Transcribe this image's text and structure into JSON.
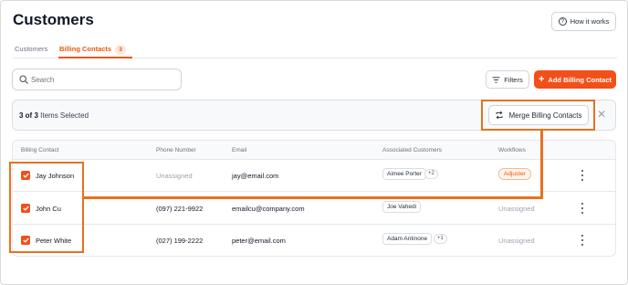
{
  "page": {
    "title": "Customers",
    "how_it_works": "How it works"
  },
  "tabs": [
    {
      "label": "Customers",
      "active": false
    },
    {
      "label": "Billing Contacts",
      "active": true,
      "count": "3"
    }
  ],
  "search": {
    "placeholder": "Search",
    "value": ""
  },
  "toolbar": {
    "filters_label": "Filters",
    "add_label": "Add Billing Contact"
  },
  "selection": {
    "count_text": "3 of 3",
    "suffix": "Items Selected",
    "merge_label": "Merge Billing Contacts"
  },
  "table": {
    "headers": [
      "Billing Contact",
      "Phone Number",
      "Email",
      "Associated Customers",
      "Workflows"
    ],
    "rows": [
      {
        "name": "Jay Johnson",
        "phone": "Unassigned",
        "email": "jay@email.com",
        "customer": "Aimee Porter",
        "more": "+2",
        "workflow": "Adjuster",
        "checked": true
      },
      {
        "name": "John Cu",
        "phone": "(097) 221-9922",
        "email": "emailcu@company.com",
        "customer": "Joe Vahedi",
        "more": "",
        "workflow": "Unassigned",
        "checked": true
      },
      {
        "name": "Peter White",
        "phone": "(027) 199-2222",
        "email": "peter@email.com",
        "customer": "Adam Antinone",
        "more": "+1",
        "workflow": "Unassigned",
        "checked": true
      }
    ]
  },
  "colors": {
    "accent": "#f2501a",
    "highlight": "#e8711f"
  }
}
